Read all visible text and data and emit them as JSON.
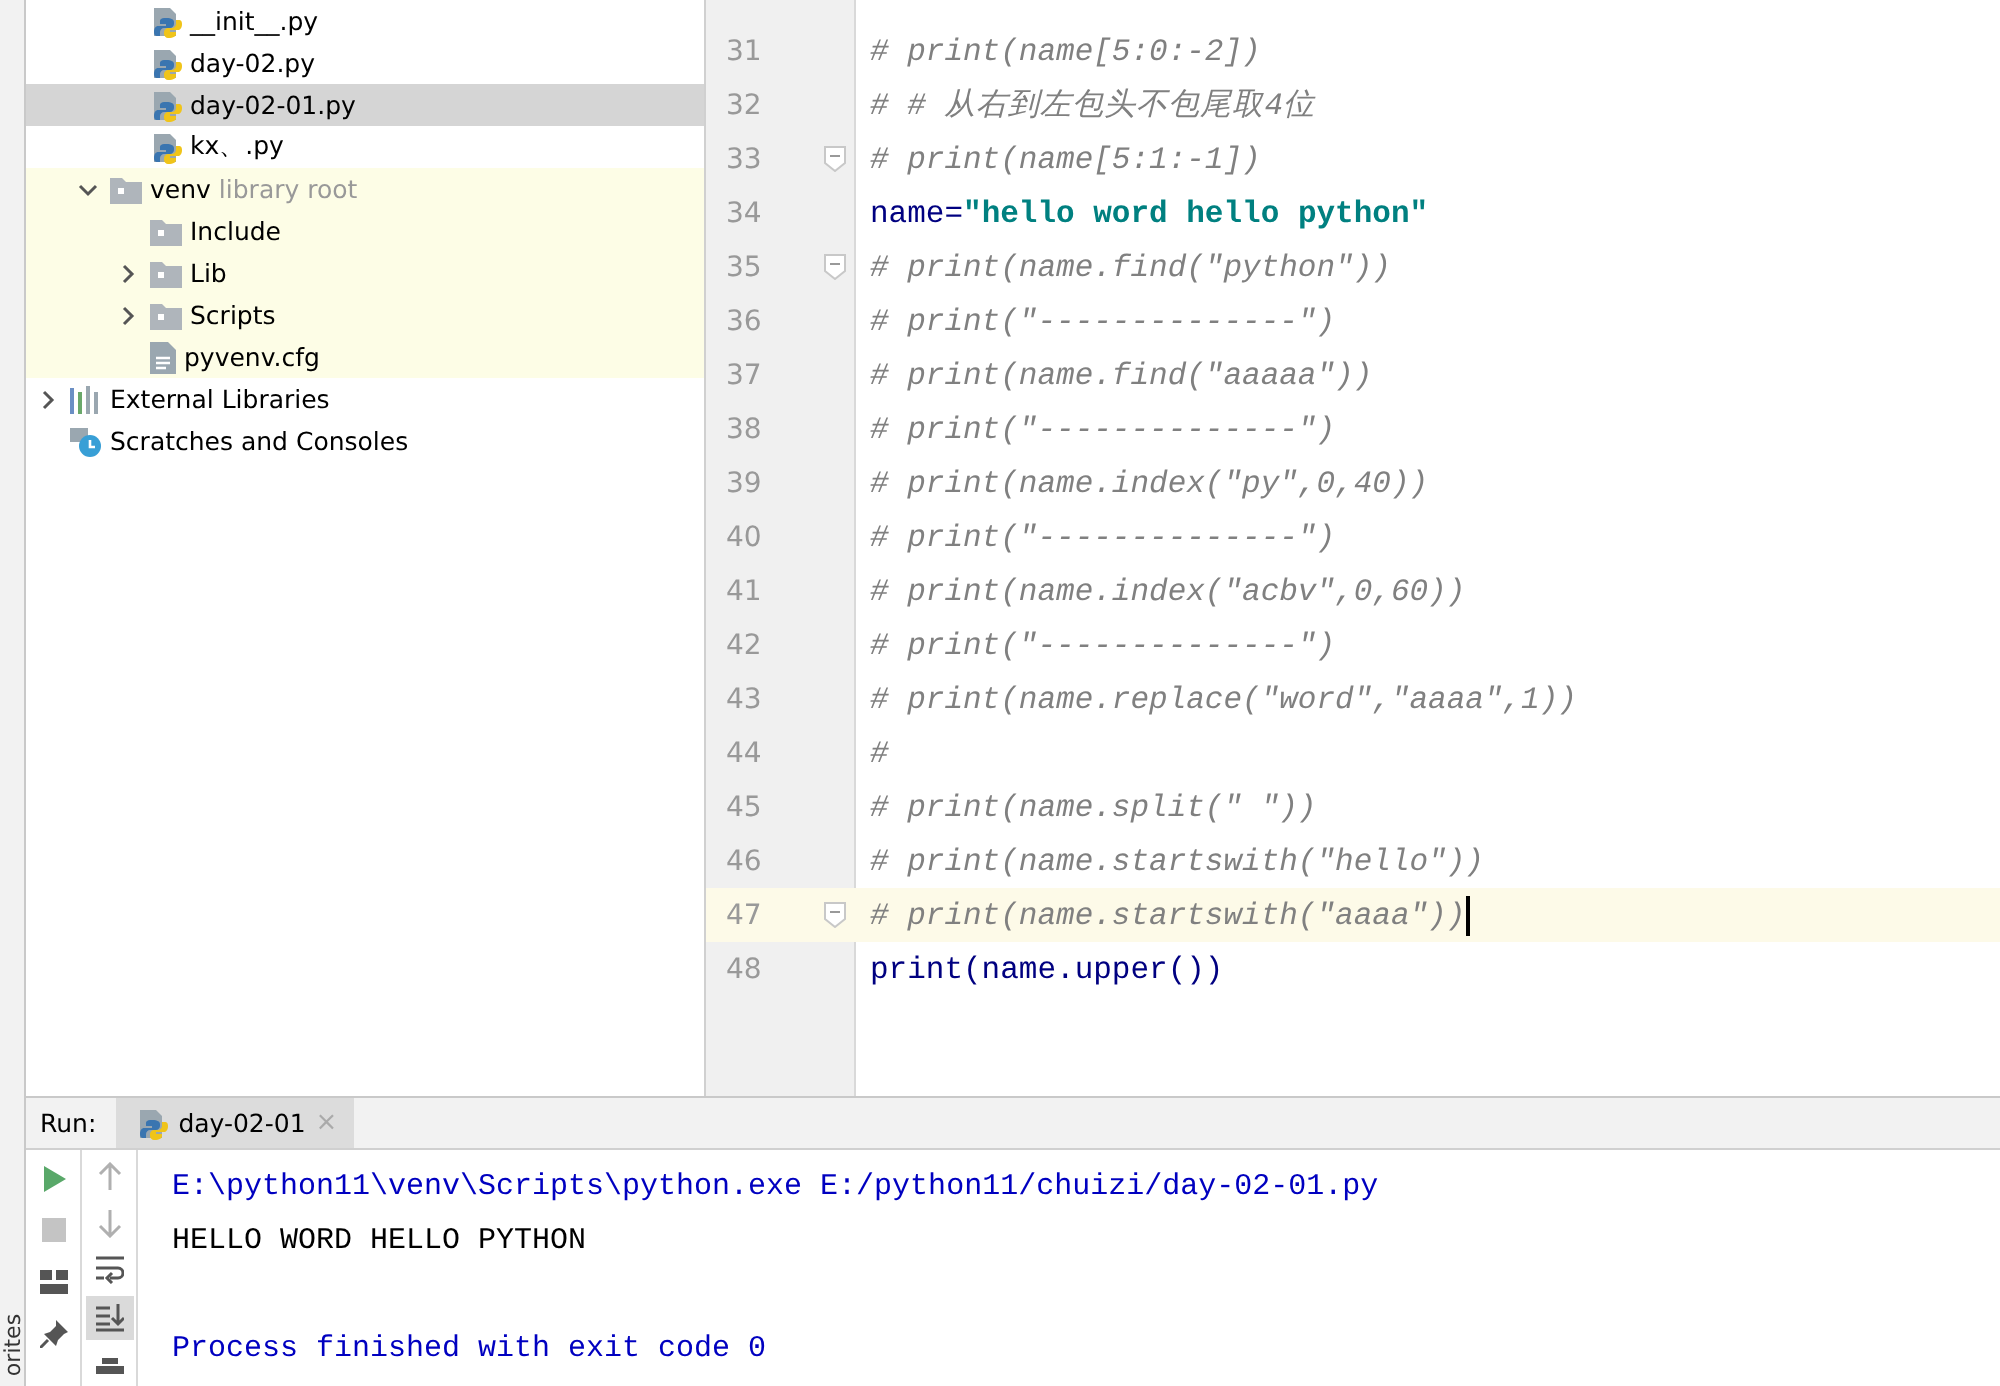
{
  "side_strip": {
    "label": "orites"
  },
  "project_tree": [
    {
      "label": "__init__.py",
      "kind": "python",
      "selected": false
    },
    {
      "label": "day-02.py",
      "kind": "python",
      "selected": false
    },
    {
      "label": "day-02-01.py",
      "kind": "python",
      "selected": true
    },
    {
      "label": "kx、.py",
      "kind": "python",
      "selected": false
    },
    {
      "label": "venv",
      "note": "library root",
      "kind": "folder",
      "expanded": true,
      "selected": false,
      "children": [
        {
          "label": "Include",
          "kind": "folder",
          "selected": false
        },
        {
          "label": "Lib",
          "kind": "folder",
          "expanded": false,
          "selected": false
        },
        {
          "label": "Scripts",
          "kind": "folder",
          "expanded": false,
          "selected": false
        },
        {
          "label": "pyvenv.cfg",
          "kind": "config",
          "selected": false
        }
      ]
    },
    {
      "label": "External Libraries",
      "kind": "libraries",
      "expanded": false,
      "selected": false,
      "top": true
    },
    {
      "label": "Scratches and Consoles",
      "kind": "scratches",
      "selected": false,
      "top": true
    }
  ],
  "editor": {
    "lines": [
      {
        "number": "31",
        "segments": [
          {
            "text": "# print(name[5:0:-2])",
            "kind": "comment"
          }
        ]
      },
      {
        "number": "32",
        "segments": [
          {
            "text": "# # 从右到左包头不包尾取4位",
            "kind": "comment"
          }
        ]
      },
      {
        "number": "33",
        "fold": true,
        "segments": [
          {
            "text": "# print(name[5:1:-1])",
            "kind": "comment"
          }
        ]
      },
      {
        "number": "34",
        "segments": [
          {
            "text": "name=",
            "kind": "code"
          },
          {
            "text": "\"hello word hello python\"",
            "kind": "string"
          }
        ]
      },
      {
        "number": "35",
        "fold": true,
        "segments": [
          {
            "text": "# print(name.find(\"python\"))",
            "kind": "comment"
          }
        ]
      },
      {
        "number": "36",
        "segments": [
          {
            "text": "# print(\"--------------\")",
            "kind": "comment"
          }
        ]
      },
      {
        "number": "37",
        "segments": [
          {
            "text": "# print(name.find(\"aaaaa\"))",
            "kind": "comment"
          }
        ]
      },
      {
        "number": "38",
        "segments": [
          {
            "text": "# print(\"--------------\")",
            "kind": "comment"
          }
        ]
      },
      {
        "number": "39",
        "segments": [
          {
            "text": "# print(name.index(\"py\",0,40))",
            "kind": "comment"
          }
        ]
      },
      {
        "number": "40",
        "segments": [
          {
            "text": "# print(\"--------------\")",
            "kind": "comment"
          }
        ]
      },
      {
        "number": "41",
        "segments": [
          {
            "text": "# print(name.index(\"acbv\",0,60))",
            "kind": "comment"
          }
        ]
      },
      {
        "number": "42",
        "segments": [
          {
            "text": "# print(\"--------------\")",
            "kind": "comment"
          }
        ]
      },
      {
        "number": "43",
        "segments": [
          {
            "text": "# print(name.replace(\"word\",\"aaaa\",1))",
            "kind": "comment"
          }
        ]
      },
      {
        "number": "44",
        "segments": [
          {
            "text": "#",
            "kind": "comment"
          }
        ]
      },
      {
        "number": "45",
        "segments": [
          {
            "text": "# print(name.split(\" \"))",
            "kind": "comment"
          }
        ]
      },
      {
        "number": "46",
        "segments": [
          {
            "text": "# print(name.startswith(\"hello\"))",
            "kind": "comment"
          }
        ]
      },
      {
        "number": "47",
        "fold": true,
        "current": true,
        "segments": [
          {
            "text": "# print(name.startswith(\"aaaa\"))",
            "kind": "comment"
          }
        ]
      },
      {
        "number": "48",
        "segments": [
          {
            "text": "print(name.upper())",
            "kind": "code"
          }
        ]
      }
    ]
  },
  "run_panel": {
    "label": "Run:",
    "tabs": [
      {
        "label": "day-02-01",
        "close": "×",
        "selected": true
      }
    ],
    "left_tools": [
      {
        "kind": "run"
      },
      {
        "kind": "stop"
      },
      {
        "kind": "layout"
      },
      {
        "kind": "pin"
      }
    ],
    "right_tools": [
      {
        "kind": "up",
        "on": false
      },
      {
        "kind": "down",
        "on": false
      },
      {
        "kind": "wrap",
        "on": false
      },
      {
        "kind": "scroll-end",
        "on": true
      },
      {
        "kind": "print",
        "on": false
      }
    ],
    "output": [
      {
        "text": "E:\\python11\\venv\\Scripts\\python.exe E:/python11/chuizi/day-02-01.py",
        "kind": "info"
      },
      {
        "text": "HELLO WORD HELLO PYTHON",
        "kind": "stdout"
      },
      {
        "kind": "blank"
      },
      {
        "text": "Process finished with exit code 0",
        "kind": "info"
      }
    ]
  }
}
